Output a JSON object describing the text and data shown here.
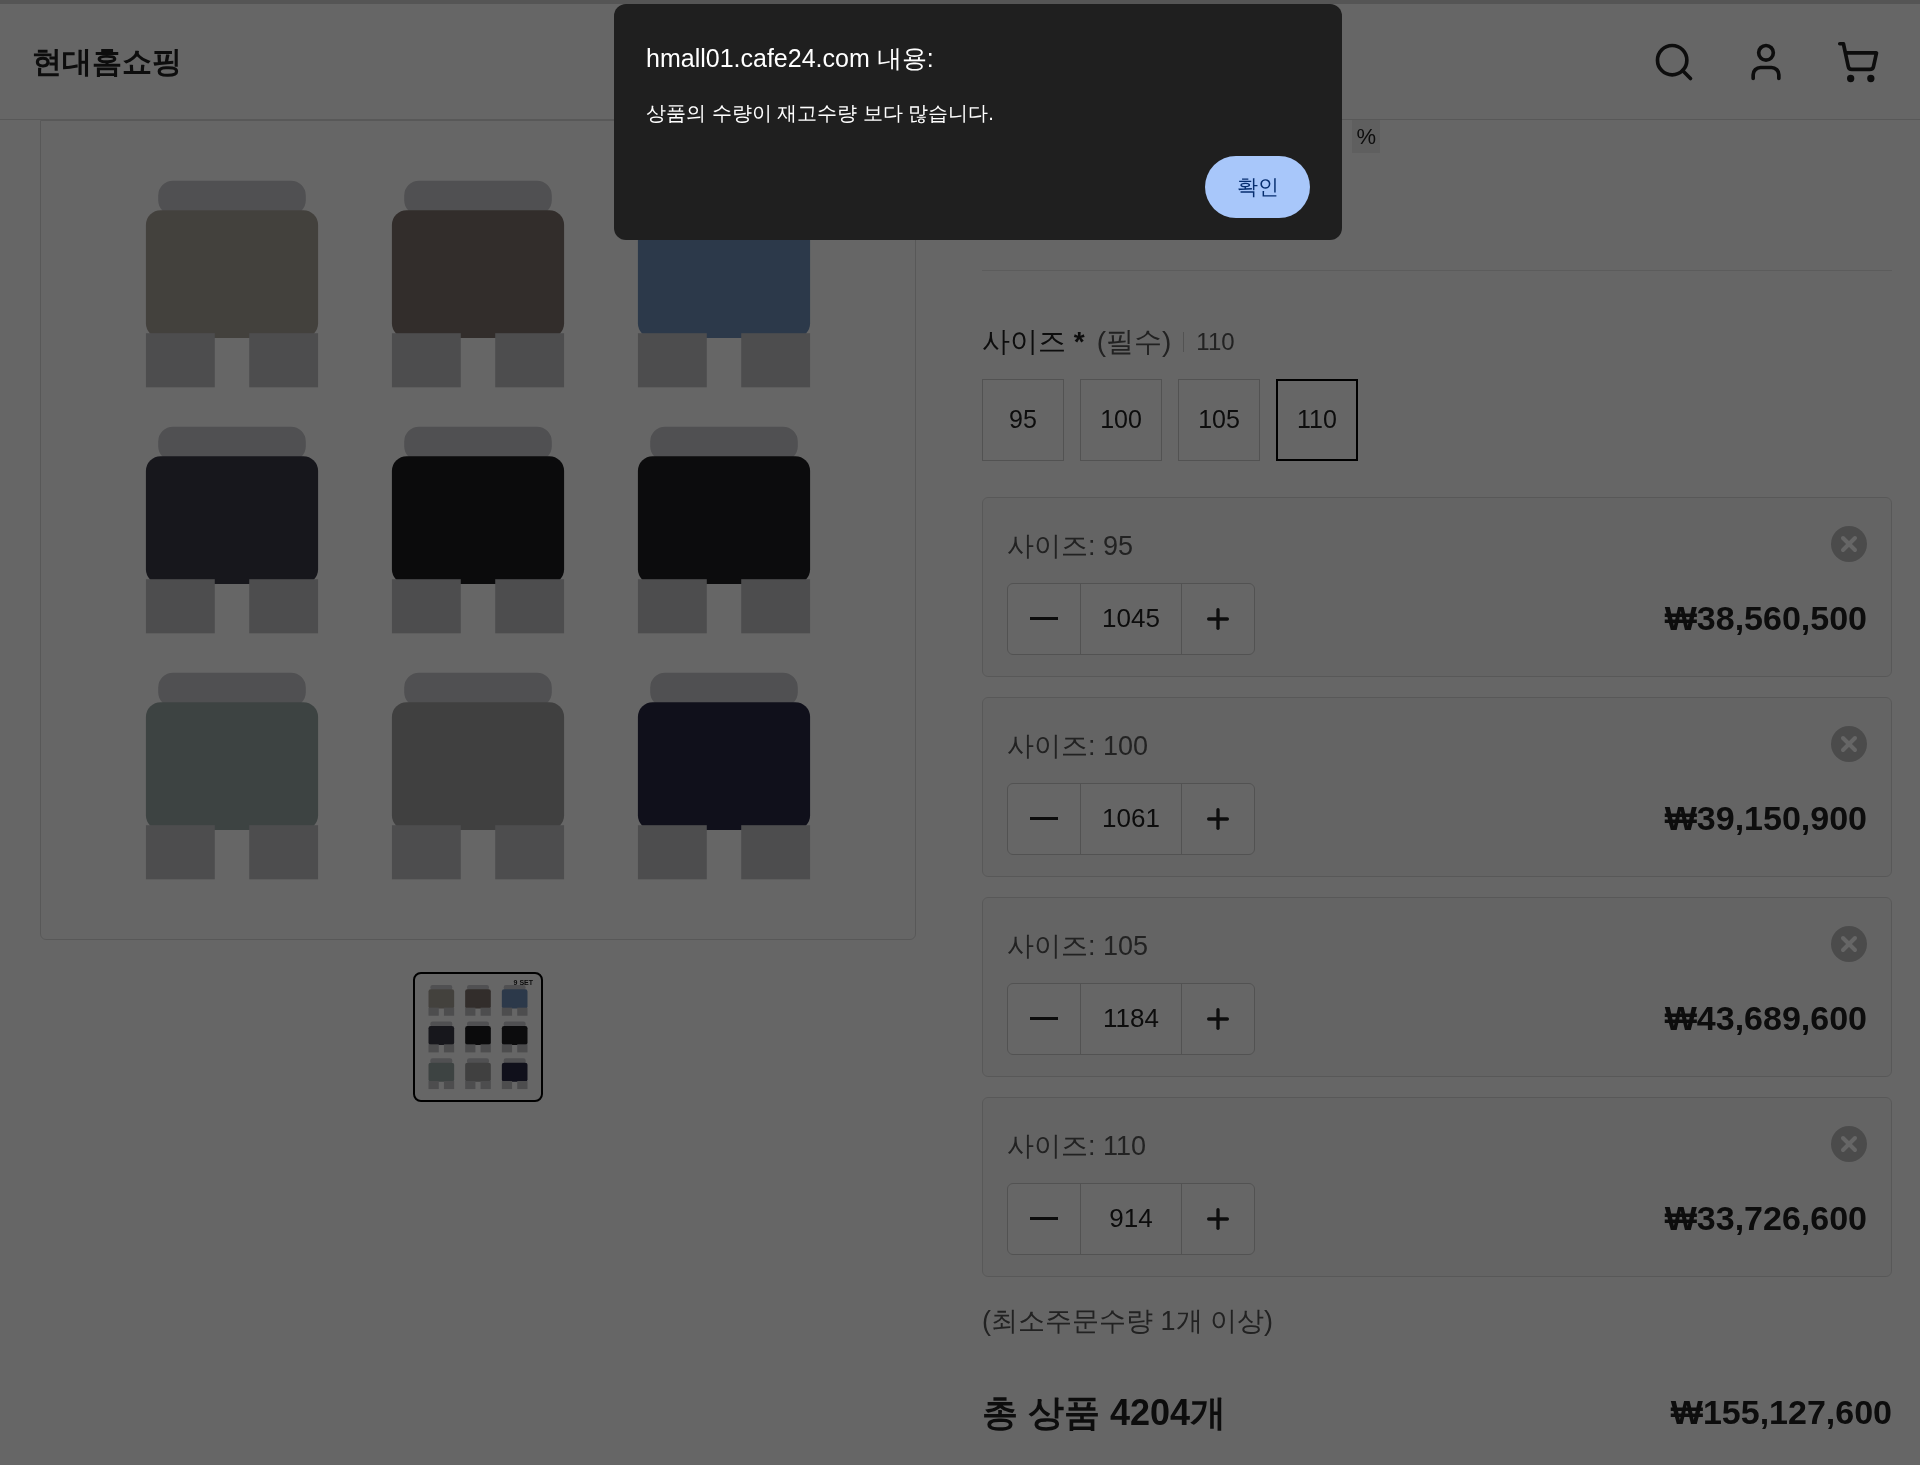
{
  "header": {
    "logo": "현대홈쇼핑"
  },
  "gallery": {
    "thumbnails": [
      {
        "badge": "9 SET",
        "selected": true
      }
    ]
  },
  "product": {
    "discount_fragment": "%",
    "option": {
      "label": "사이즈",
      "required_mark": "*",
      "required_text": "(필수)",
      "selected_value": "110",
      "values": [
        {
          "label": "95",
          "selected": false
        },
        {
          "label": "100",
          "selected": false
        },
        {
          "label": "105",
          "selected": false
        },
        {
          "label": "110",
          "selected": true
        }
      ]
    },
    "items": [
      {
        "label": "사이즈: 95",
        "quantity": "1045",
        "price": "₩38,560,500"
      },
      {
        "label": "사이즈: 100",
        "quantity": "1061",
        "price": "₩39,150,900"
      },
      {
        "label": "사이즈: 105",
        "quantity": "1184",
        "price": "₩43,689,600"
      },
      {
        "label": "사이즈: 110",
        "quantity": "914",
        "price": "₩33,726,600"
      }
    ],
    "min_order_note": "(최소주문수량 1개 이상)",
    "total": {
      "label": "총 상품 4204개",
      "price": "₩155,127,600"
    }
  },
  "dialog": {
    "title": "hmall01.cafe24.com 내용:",
    "message": "상품의 수량이 재고수량 보다 많습니다.",
    "button": "확인"
  }
}
